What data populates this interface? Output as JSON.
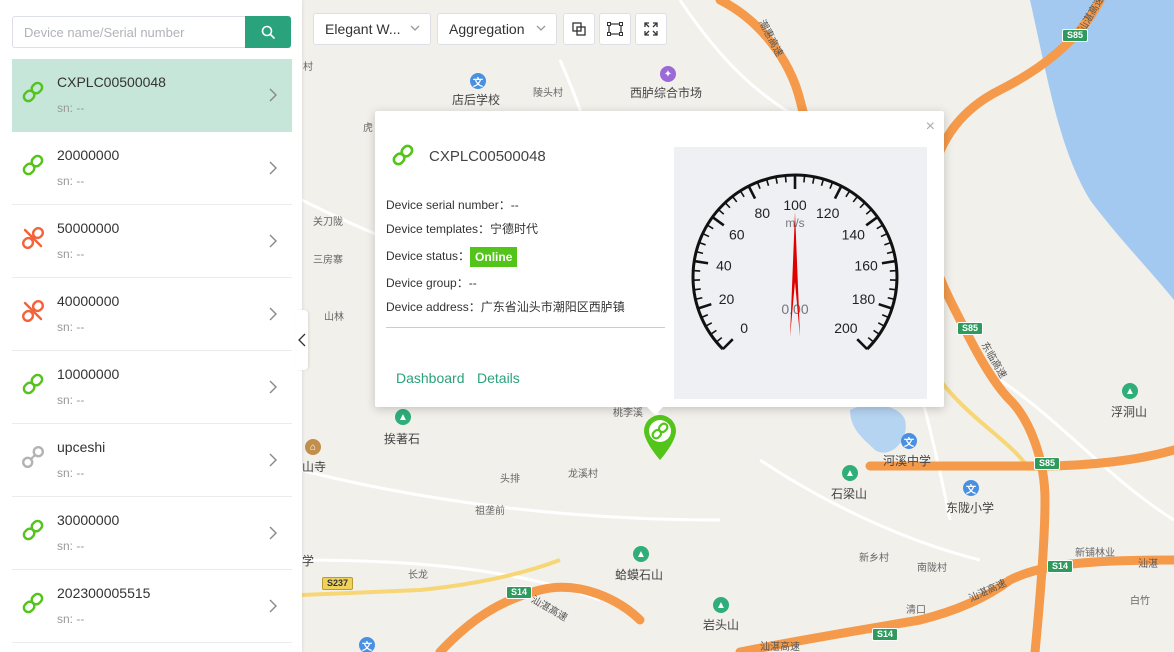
{
  "search": {
    "placeholder": "Device name/Serial number"
  },
  "devices": [
    {
      "name": "CXPLC00500048",
      "sn": "sn: --",
      "status": "online",
      "active": true
    },
    {
      "name": "20000000",
      "sn": "sn: --",
      "status": "online",
      "active": false
    },
    {
      "name": "50000000",
      "sn": "sn: --",
      "status": "offline",
      "active": false
    },
    {
      "name": "40000000",
      "sn": "sn: --",
      "status": "offline",
      "active": false
    },
    {
      "name": "10000000",
      "sn": "sn: --",
      "status": "online",
      "active": false
    },
    {
      "name": "upceshi",
      "sn": "sn: --",
      "status": "unconnected",
      "active": false
    },
    {
      "name": "30000000",
      "sn": "sn: --",
      "status": "online",
      "active": false
    },
    {
      "name": "202300005515",
      "sn": "sn: --",
      "status": "online",
      "active": false
    }
  ],
  "toolbar": {
    "map_style": "Elegant W...",
    "mode": "Aggregation"
  },
  "popup": {
    "title": "CXPLC00500048",
    "serial_label": "Device serial number：",
    "serial_value": "--",
    "template_label": "Device templates：",
    "template_value": "宁德时代",
    "status_label": "Device status：",
    "status_value": "Online",
    "group_label": "Device group：",
    "group_value": "--",
    "address_label": "Device address：",
    "address_value": "广东省汕头市潮阳区西胪镇",
    "dashboard_link": "Dashboard",
    "details_link": "Details",
    "close": "×"
  },
  "gauge": {
    "unit": "m/s",
    "value": 0,
    "value_text": "0.00",
    "min": 0,
    "max": 200,
    "ticks": [
      "0",
      "20",
      "40",
      "60",
      "80",
      "100",
      "120",
      "140",
      "160",
      "180",
      "200"
    ],
    "needle_value": 100
  },
  "map": {
    "labels": [
      "店后学校",
      "陵头村",
      "西胪综合市场",
      "关刀陇",
      "三房寨",
      "山林",
      "挨著石",
      "桃李溪",
      "头排",
      "龙溪村",
      "祖垄前",
      "长龙",
      "蛤蟆石山",
      "岩头山",
      "河溪中学",
      "石梁山",
      "东陇小学",
      "浮洞山",
      "新乡村",
      "南陇村",
      "清口",
      "新铺林业",
      "白竹",
      "村",
      "虎",
      "学",
      "山寺"
    ],
    "roads": [
      "潮惠高速",
      "汕湛高速",
      "汕湛高速",
      "汕湛",
      "汕湛高速",
      "东临高速",
      "汕湛高速"
    ],
    "shields": [
      "S85",
      "S85",
      "S85",
      "S14",
      "S14",
      "S14",
      "S237"
    ]
  }
}
